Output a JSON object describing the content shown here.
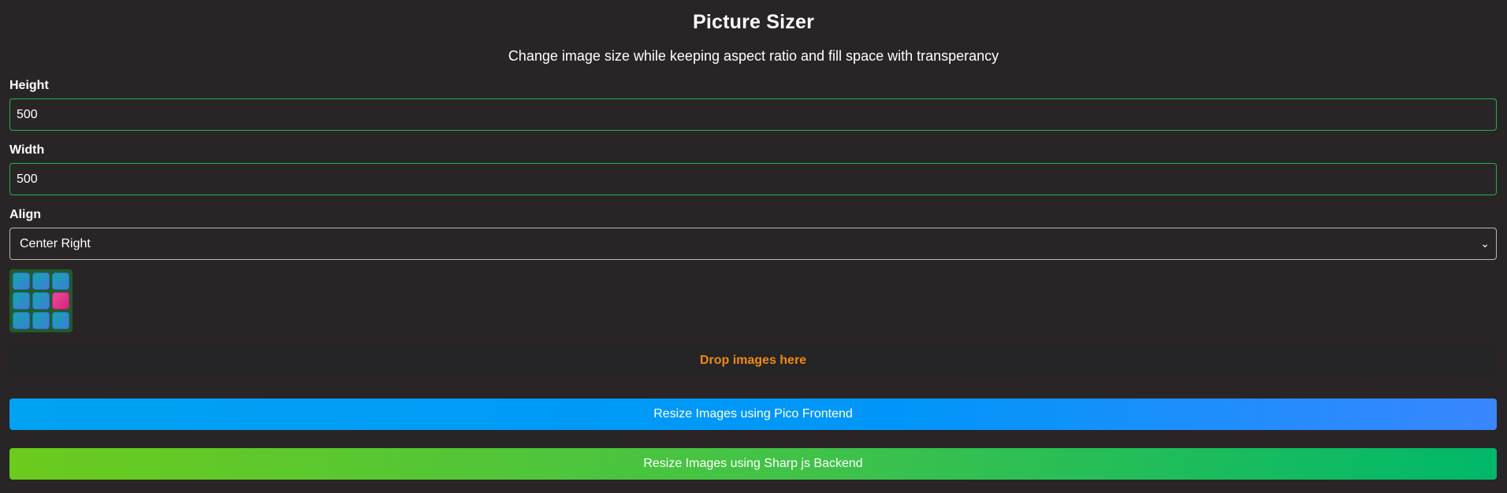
{
  "header": {
    "title": "Picture Sizer",
    "subtitle": "Change image size while keeping aspect ratio and fill space with transperancy"
  },
  "form": {
    "height": {
      "label": "Height",
      "value": "500"
    },
    "width": {
      "label": "Width",
      "value": "500"
    },
    "align": {
      "label": "Align",
      "selected": "Center Right",
      "chevron_icon": "chevron-down-icon"
    },
    "alignment_grid": {
      "rows": 3,
      "cols": 3,
      "selected": "middle-right",
      "cell_color": "#3f7ddc",
      "selected_color": "#e74b9c",
      "background": "#1f5b2c"
    }
  },
  "dropzone": {
    "text": "Drop images here",
    "color": "#f08a0c"
  },
  "actions": {
    "frontend_label": "Resize Images using Pico Frontend",
    "backend_label": "Resize Images using Sharp js Backend",
    "frontend_color": "#0096f9",
    "backend_color": "#3fc24a"
  }
}
